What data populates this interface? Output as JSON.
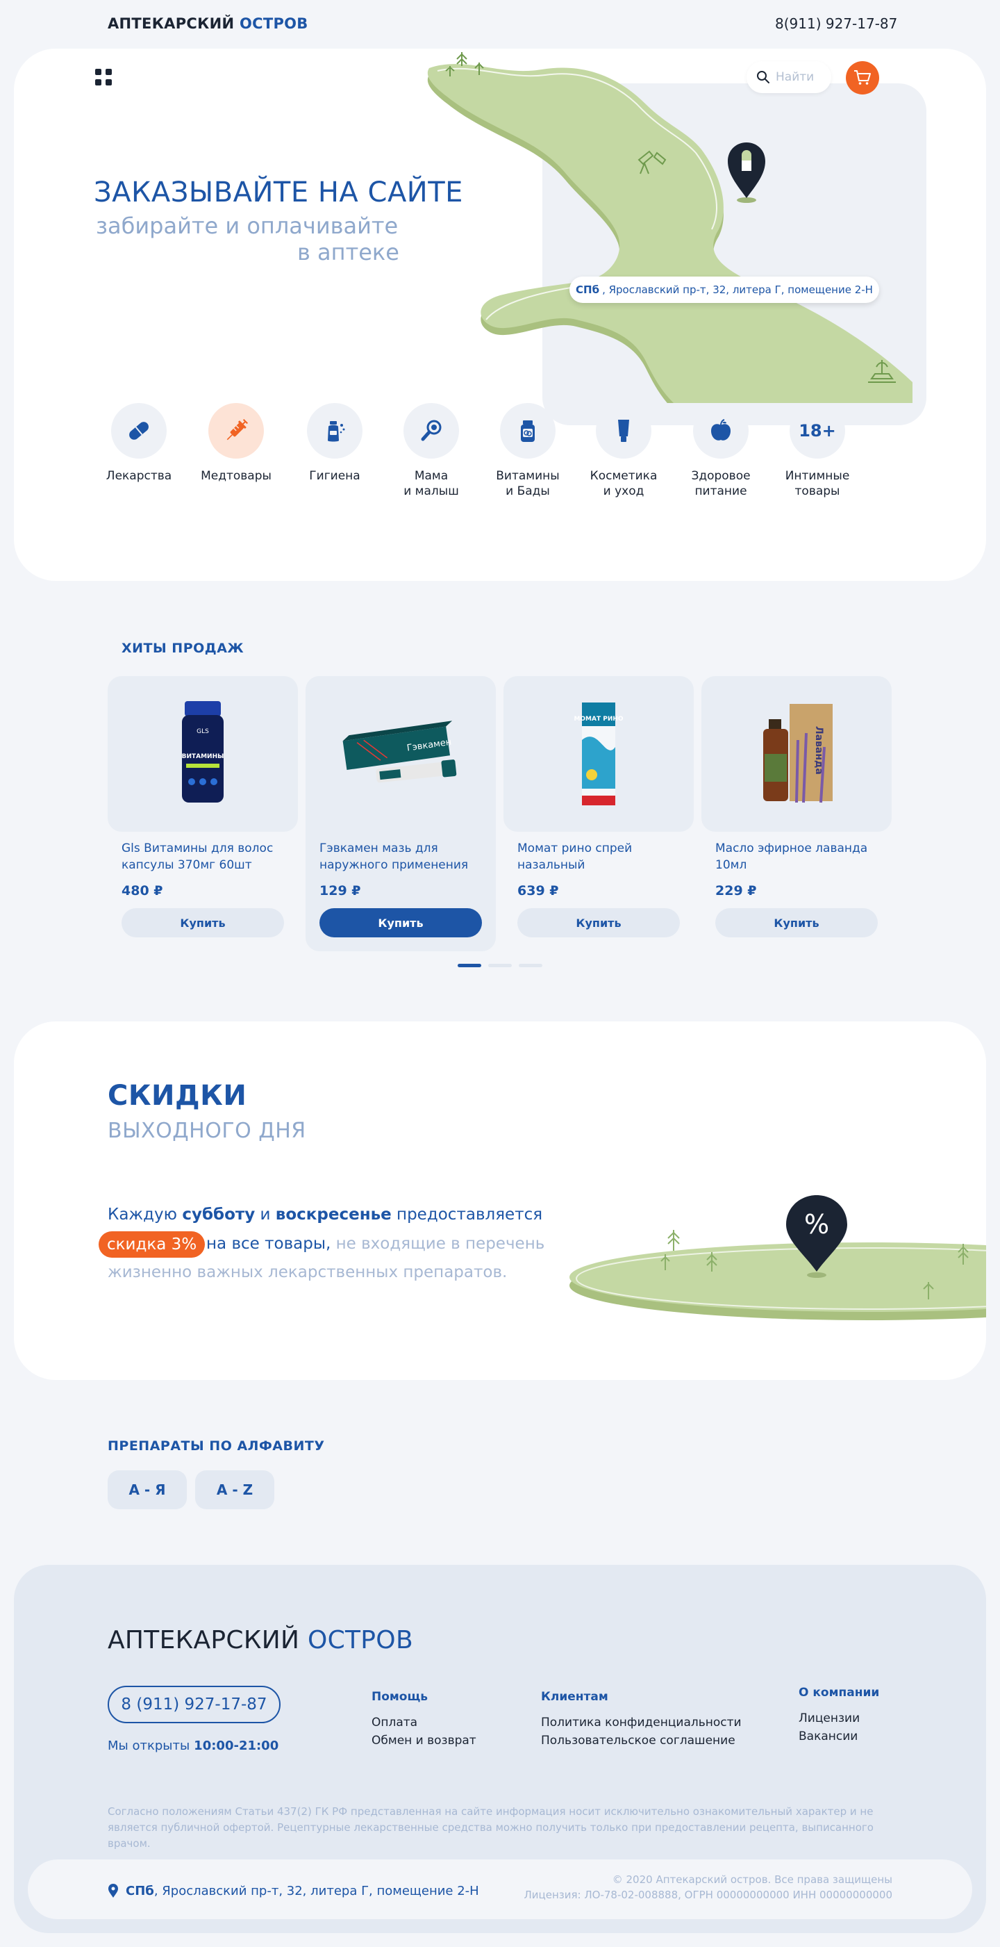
{
  "brand": {
    "part1": "АПТЕКАРСКИЙ",
    "part2": "ОСТРОВ"
  },
  "header": {
    "phone": "8(911) 927-17-87"
  },
  "hero": {
    "title": "ЗАКАЗЫВАЙТЕ НА САЙТЕ",
    "subtitle_line1": "забирайте и оплачивайте",
    "subtitle_line2": "в аптеке",
    "search_placeholder": "Найти",
    "address_city": "СПб",
    "address_rest": ", Ярославский пр-т, 32, литера Г, помещение 2-Н"
  },
  "categories": [
    {
      "label": "Лекарства",
      "icon": "pill-icon"
    },
    {
      "label": "Медтовары",
      "icon": "syringe-icon"
    },
    {
      "label": "Гигиена",
      "icon": "hygiene-bottle-icon"
    },
    {
      "label": "Мама\nи малыш",
      "icon": "baby-rattle-icon"
    },
    {
      "label": "Витамины\nи Бады",
      "icon": "vitamin-jar-icon"
    },
    {
      "label": "Косметика\nи уход",
      "icon": "cosmetics-tube-icon"
    },
    {
      "label": "Здоровое\nпитание",
      "icon": "apple-icon"
    },
    {
      "label": "Интимные\nтовары",
      "icon_text": "18+"
    }
  ],
  "hits": {
    "title": "ХИТЫ ПРОДАЖ",
    "buy_label": "Купить",
    "products": [
      {
        "name": "Gls Витамины для волос капсулы 370мг 60шт",
        "price": "480 ₽",
        "image_text": "ВИТАМИНЫ"
      },
      {
        "name": "Гэвкамен мазь для наружного применения т...",
        "price": "129 ₽",
        "image_text": "Гэвкамен"
      },
      {
        "name": "Момат рино спрей назальный дозированный...",
        "price": "639 ₽",
        "image_text": "МОМАТ РИНО"
      },
      {
        "name": "Масло эфирное лаванда 10мл",
        "price": "229 ₽",
        "image_text": "Лаванда"
      }
    ]
  },
  "discount": {
    "title": "СКИДКИ",
    "subtitle": "ВЫХОДНОГО ДНЯ",
    "t1": "Каждую ",
    "t2": "субботу",
    "t3": " и ",
    "t4": "воскресенье",
    "t5": " предоставляется",
    "badge": "скидка 3%",
    "t6": "на все товары,",
    "t7": " не входящие в перечень",
    "t8": "жизненно важных лекарственных препаратов.",
    "pin_text": "%"
  },
  "alphabet": {
    "title": "ПРЕПАРАТЫ ПО АЛФАВИТУ",
    "buttons": [
      "А - Я",
      "A - Z"
    ]
  },
  "footer": {
    "phone": "8 (911) 927-17-87",
    "hours_label": "Мы открыты",
    "hours": "10:00-21:00",
    "columns": [
      {
        "heading": "Помощь",
        "items": [
          "Оплата",
          "Обмен и возврат"
        ]
      },
      {
        "heading": "Клиентам",
        "items": [
          "Политика конфиденциальности",
          "Пользовательское соглашение"
        ]
      },
      {
        "heading": "О компании",
        "items": [
          "Лицензии",
          "Вакансии"
        ]
      }
    ],
    "disclaimer": "Согласно положениям Статьи 437(2) ГК РФ представленная на сайте информация носит исключительно ознакомительный характер и не является публичной офертой. Рецептурные лекарственные средства можно получить только при предоставлении рецепта, выписанного врачом.",
    "address_city": "СПб",
    "address_rest": ", Ярославский пр-т, 32, литера Г, помещение 2-Н",
    "copyright": "© 2020 Аптекарский остров. Все права защищены",
    "license": "Лицензия: ЛО-78-02-008888, ОГРН 00000000000 ИНН 00000000000"
  },
  "colors": {
    "brand_blue": "#1d55a6",
    "accent_orange": "#f16323",
    "map_green": "#c4d8a3",
    "muted_blue": "#8fa8cc"
  }
}
